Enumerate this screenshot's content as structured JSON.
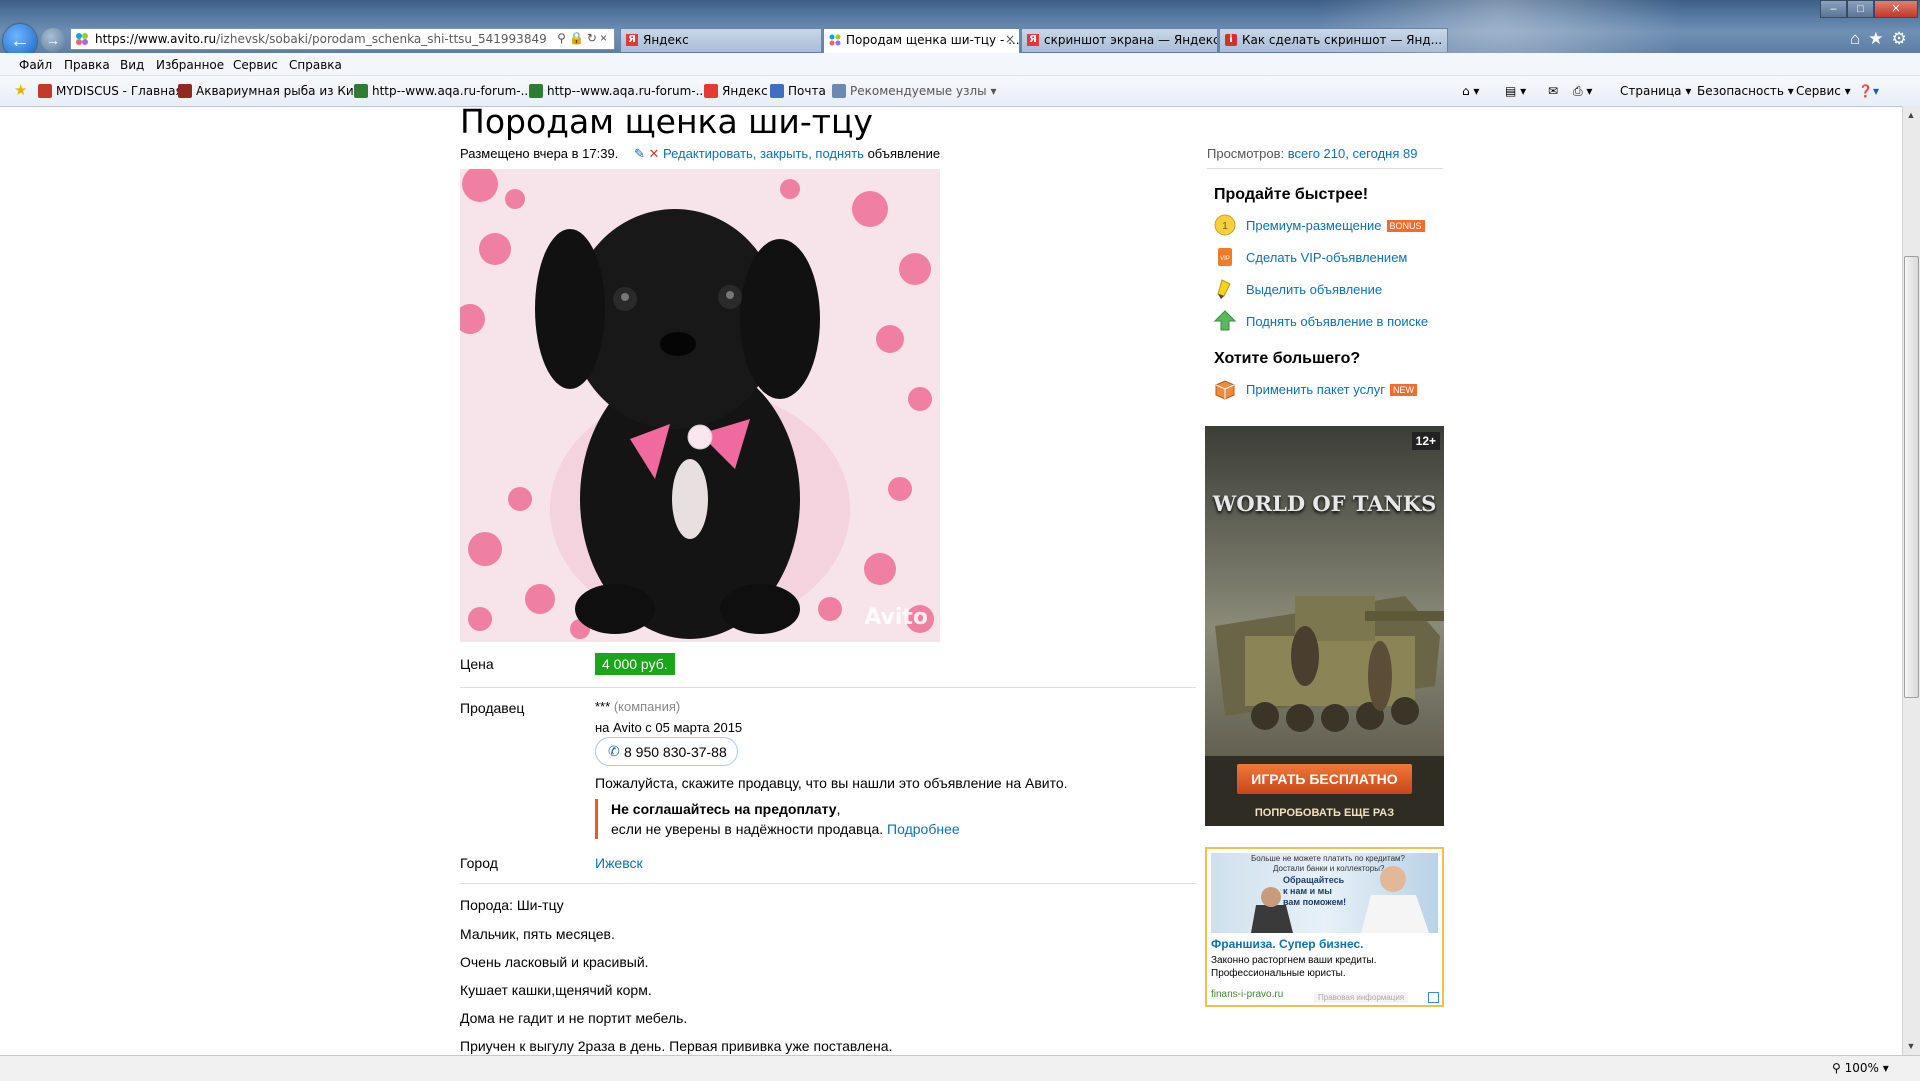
{
  "browser": {
    "address_url_host": "https://www.avito.ru",
    "address_url_path": "/izhevsk/sobaki/porodam_schenka_shi-ttsu_541993849",
    "tabs": [
      {
        "label": "Яндекс",
        "active": false,
        "icon": "yandex-icon"
      },
      {
        "label": "Породам щенка ши-тцу - ...",
        "active": true,
        "icon": "avito-icon"
      },
      {
        "label": "скриншот экрана — Яндекс: ...",
        "active": false,
        "icon": "yandex-icon"
      },
      {
        "label": "Как сделать скриншот — Янд...",
        "active": false,
        "icon": "info-icon"
      }
    ],
    "menu": [
      "Файл",
      "Правка",
      "Вид",
      "Избранное",
      "Сервис",
      "Справка"
    ],
    "favorites": [
      {
        "label": "MYDISCUS - Главная",
        "color": "#c0392b"
      },
      {
        "label": "Аквариумная рыба из Ки...",
        "color": "#8e2a1e"
      },
      {
        "label": "http--www.aqa.ru-forum-...",
        "color": "#2e7d32"
      },
      {
        "label": "http--www.aqa.ru-forum-...",
        "color": "#2e7d32"
      },
      {
        "label": "Яндекс",
        "color": "#e53935"
      },
      {
        "label": "Почта",
        "color": "#3d6ebf"
      },
      {
        "label": "Рекомендуемые узлы ▾",
        "color": "#6a8ab0"
      }
    ],
    "commands": [
      "Страница ▾",
      "Безопасность ▾",
      "Сервис ▾"
    ],
    "zoom": "100%"
  },
  "ad": {
    "title": "Породам щенка ши-тцу",
    "posted": "Размещено вчера в 17:39.",
    "edit_link": "Редактировать, закрыть, поднять",
    "edit_suffix": "объявление",
    "views_label": "Просмотров:",
    "views_value": "всего 210, сегодня 89",
    "photo_watermark": "Avito",
    "price_label": "Цена",
    "price_value": "4 000 руб.",
    "seller_label": "Продавец",
    "seller_name": "***",
    "seller_type": "(компания)",
    "seller_since": "на Avito с 05 марта 2015",
    "phone": "8 950 830-37-88",
    "please_say": "Пожалуйста, скажите продавцу, что вы нашли это объявление на Авито.",
    "warn_bold": "Не соглашайтесь на предоплату",
    "warn_comma": ",",
    "warn_text": "если не уверены в надёжности продавца.",
    "warn_link": "Подробнее",
    "city_label": "Город",
    "city_value": "Ижевск",
    "description": [
      "Порода: Ши-тцу",
      "Мальчик, пять месяцев.",
      "Очень ласковый и красивый.",
      "Кушает кашки,щенячий корм.",
      "Дома не гадит и не портит мебель.",
      "Приучен к выгулу 2раза в день. Первая прививка уже поставлена."
    ]
  },
  "sidebar": {
    "sell_faster": "Продайте быстрее!",
    "promos": [
      {
        "label": "Премиум-размещение",
        "tag": "BONUS",
        "icon": "coin-icon"
      },
      {
        "label": "Сделать VIP-объявлением",
        "tag": "",
        "icon": "vip-icon"
      },
      {
        "label": "Выделить объявление",
        "tag": "",
        "icon": "highlighter-icon"
      },
      {
        "label": "Поднять объявление в поиске",
        "tag": "",
        "icon": "arrow-up-icon"
      }
    ],
    "want_more": "Хотите большего?",
    "package": {
      "label": "Применить пакет услуг",
      "tag": "NEW",
      "icon": "package-icon"
    },
    "wot_ad": {
      "age": "12+",
      "logo": "WORLD OF TANKS",
      "cta": "ИГРАТЬ БЕСПЛАТНО",
      "sub": "ПОПРОБОВАТЬ ЕЩЕ РАЗ"
    },
    "finans_ad": {
      "img_top": "Больше не можете платить по кредитам?",
      "img_mid": "Достали банки и коллекторы?",
      "img_callout": "Обращайтесь к нам и мы вам поможем!",
      "headline": "Франшиза. Супер бизнес.",
      "text1": "Законно расторгнем ваши кредиты.",
      "text2": "Профессиональные юристы.",
      "domain": "finans-i-pravo.ru",
      "footer": "Правовая информация"
    }
  }
}
